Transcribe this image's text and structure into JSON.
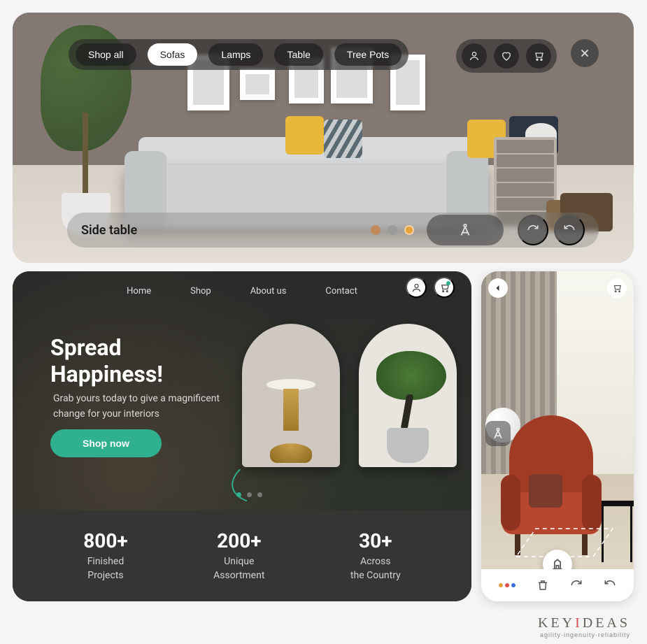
{
  "panel1": {
    "nav": [
      "Shop all",
      "Sofas",
      "Lamps",
      "Table",
      "Tree Pots"
    ],
    "nav_active_index": 1,
    "util_icons": [
      "user-icon",
      "heart-icon",
      "cart-icon"
    ],
    "bottom_label": "Side table",
    "swatches": [
      "#c08b5c",
      "#9a9a9a",
      "#e5a13c"
    ]
  },
  "panel2": {
    "nav": [
      "Home",
      "Shop",
      "About us",
      "Contact"
    ],
    "headline_line1": "Spread",
    "headline_line2": "Happiness!",
    "subtext": "Grab yours today to give a magnificent change for your interiors",
    "cta": "Shop now",
    "carousel_active": 0,
    "stats": [
      {
        "num": "800+",
        "label": "Finished\nProjects"
      },
      {
        "num": "200+",
        "label": "Unique\nAssortment"
      },
      {
        "num": "30+",
        "label": "Across\nthe Country"
      }
    ]
  },
  "panel3": {
    "toolbar_icons": [
      "palette-icon",
      "trash-icon",
      "redo-icon",
      "undo-icon"
    ]
  },
  "brand": {
    "name_pre": "KEY",
    "name_hi": "I",
    "name_post": "DEAS",
    "tagline": "agility·ingenuity·reliability"
  }
}
